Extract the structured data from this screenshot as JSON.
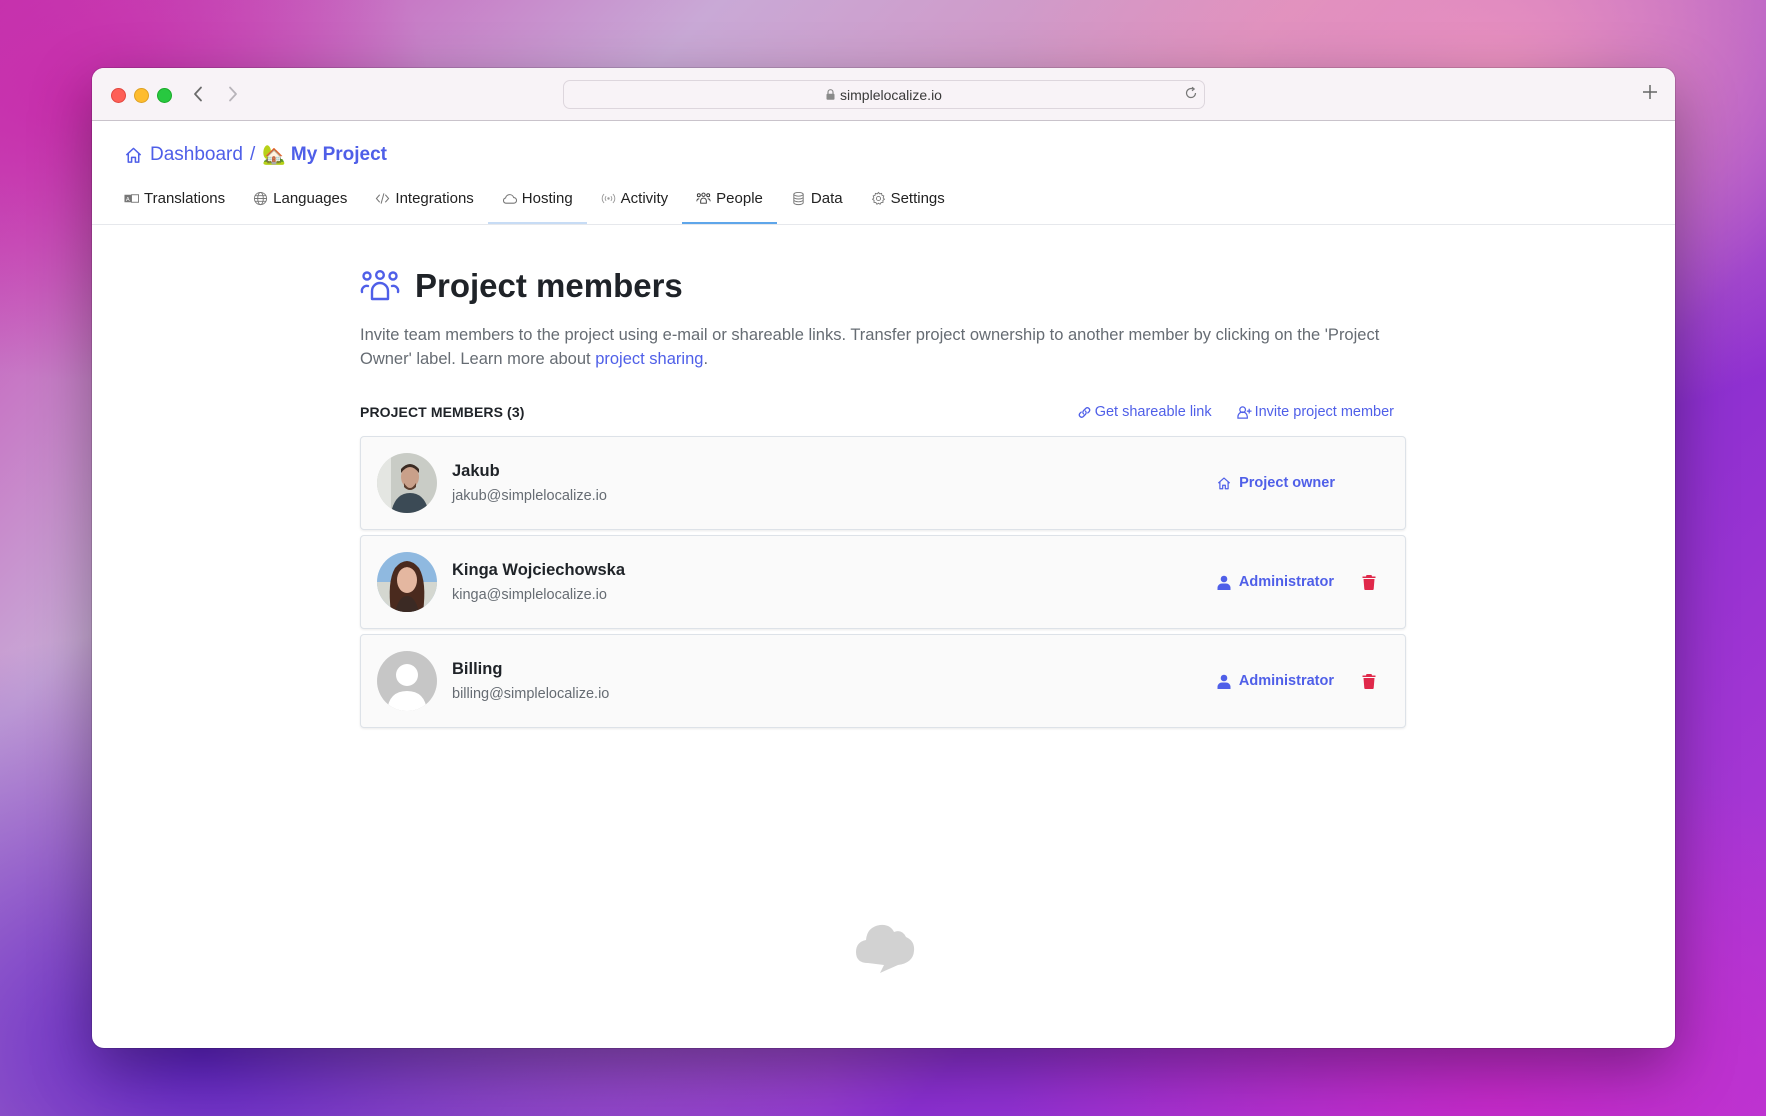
{
  "browser": {
    "url": "simplelocalize.io",
    "icons": {
      "back": "chevron-left-icon",
      "forward": "chevron-right-icon",
      "lock": "lock-icon",
      "reload": "reload-icon",
      "new_tab": "plus-icon"
    }
  },
  "breadcrumb": {
    "dashboard_label": "Dashboard",
    "separator": "/",
    "project_emoji": "🏡",
    "project_label": "My Project"
  },
  "tabs": [
    {
      "label": "Translations",
      "icon": "translate-icon"
    },
    {
      "label": "Languages",
      "icon": "globe-icon"
    },
    {
      "label": "Integrations",
      "icon": "code-icon"
    },
    {
      "label": "Hosting",
      "icon": "cloud-icon"
    },
    {
      "label": "Activity",
      "icon": "broadcast-icon"
    },
    {
      "label": "People",
      "icon": "people-icon",
      "active": true
    },
    {
      "label": "Data",
      "icon": "database-icon"
    },
    {
      "label": "Settings",
      "icon": "gear-icon"
    }
  ],
  "page": {
    "title": "Project members",
    "description_prefix": "Invite team members to the project using e-mail or shareable links. Transfer project ownership to another member by clicking on the 'Project Owner' label. Learn more about ",
    "description_link": "project sharing",
    "description_suffix": ".",
    "section_title": "PROJECT MEMBERS (3)",
    "get_link_label": "Get shareable link",
    "invite_label": "Invite project member"
  },
  "members": [
    {
      "name": "Jakub",
      "email": "jakub@simplelocalize.io",
      "role": "Project owner",
      "role_icon": "home-icon",
      "removable": false
    },
    {
      "name": "Kinga Wojciechowska",
      "email": "kinga@simplelocalize.io",
      "role": "Administrator",
      "role_icon": "user-icon",
      "removable": true
    },
    {
      "name": "Billing",
      "email": "billing@simplelocalize.io",
      "role": "Administrator",
      "role_icon": "user-icon",
      "removable": true
    }
  ],
  "colors": {
    "accent": "#4f5fe8",
    "danger": "#e0284a",
    "active_tab_underline": "#5ea6ea",
    "text_primary": "#1f2328",
    "text_secondary": "#666c73"
  }
}
